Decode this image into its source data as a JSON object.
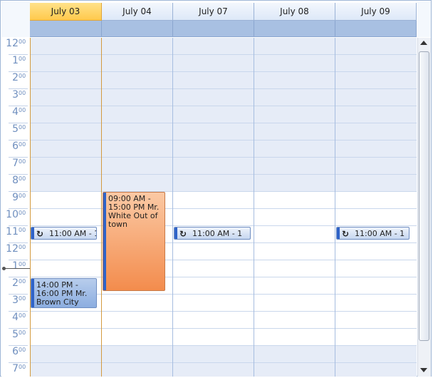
{
  "days": [
    "July 03",
    "July 04",
    "July 07",
    "July 08",
    "July 09"
  ],
  "hours": [
    {
      "h": "12",
      "m": "00"
    },
    {
      "h": "1",
      "m": "00"
    },
    {
      "h": "2",
      "m": "00"
    },
    {
      "h": "3",
      "m": "00"
    },
    {
      "h": "4",
      "m": "00"
    },
    {
      "h": "5",
      "m": "00"
    },
    {
      "h": "6",
      "m": "00"
    },
    {
      "h": "7",
      "m": "00"
    },
    {
      "h": "8",
      "m": "00"
    },
    {
      "h": "9",
      "m": "00"
    },
    {
      "h": "10",
      "m": "00"
    },
    {
      "h": "11",
      "m": "00"
    },
    {
      "h": "12",
      "m": "00"
    },
    {
      "h": "1",
      "m": "00"
    },
    {
      "h": "2",
      "m": "00"
    },
    {
      "h": "3",
      "m": "00"
    },
    {
      "h": "4",
      "m": "00"
    },
    {
      "h": "5",
      "m": "00"
    },
    {
      "h": "6",
      "m": "00"
    },
    {
      "h": "7",
      "m": "00"
    }
  ],
  "appointments": {
    "recurring_label": "11:00 AM - 1",
    "white_out_of_town": "09:00 AM - 15:00 PM  Mr. White Out of town",
    "brown_city": "14:00 PM - 16:00 PM  Mr. Brown City"
  },
  "icons": {
    "recurrence": "recurrence-icon"
  },
  "colors": {
    "today_header": "#ffc94c",
    "orange_appt": "#f38c4d",
    "blue_appt": "#8caee0"
  }
}
